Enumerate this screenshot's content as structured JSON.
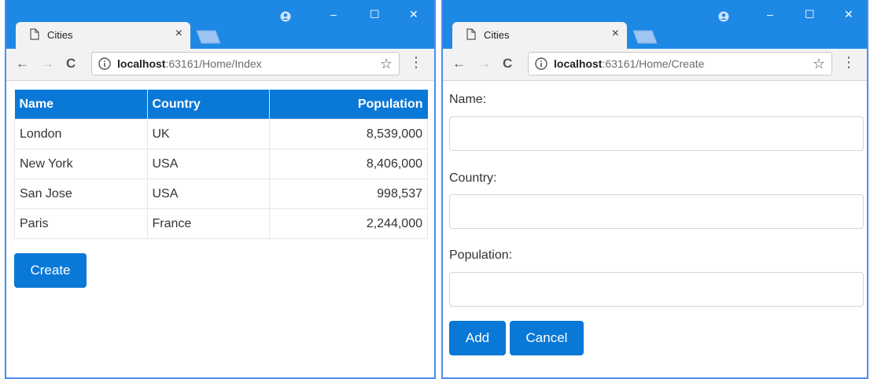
{
  "index_window": {
    "tab_title": "Cities",
    "url_host": "localhost",
    "url_rest": ":63161/Home/Index",
    "table": {
      "headers": [
        "Name",
        "Country",
        "Population"
      ],
      "rows": [
        [
          "London",
          "UK",
          "8,539,000"
        ],
        [
          "New York",
          "USA",
          "8,406,000"
        ],
        [
          "San Jose",
          "USA",
          "998,537"
        ],
        [
          "Paris",
          "France",
          "2,244,000"
        ]
      ]
    },
    "create_label": "Create"
  },
  "create_window": {
    "tab_title": "Cities",
    "url_host": "localhost",
    "url_rest": ":63161/Home/Create",
    "form": {
      "name_label": "Name:",
      "name_value": "",
      "country_label": "Country:",
      "country_value": "",
      "population_label": "Population:",
      "population_value": ""
    },
    "add_label": "Add",
    "cancel_label": "Cancel"
  },
  "chrome": {
    "close_glyph": "×",
    "back_glyph": "←",
    "forward_glyph": "→",
    "reload_glyph": "C",
    "star_glyph": "☆",
    "menu_glyph": "⋮",
    "minimize_glyph": "–",
    "maximize_glyph": "☐",
    "window_close_glyph": "✕"
  },
  "colors": {
    "titlebar": "#1e88e5",
    "primary": "#0a78d7"
  },
  "icons": [
    "document-icon",
    "new-tab-icon",
    "account-icon",
    "info-icon",
    "star-icon",
    "menu-icon"
  ]
}
